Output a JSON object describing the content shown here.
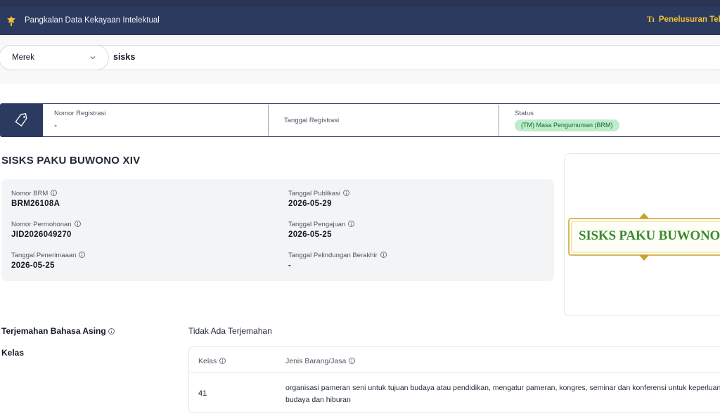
{
  "header": {
    "title": "Pangkalan Data Kekayaan Intelektual",
    "right_link_prefix": "Tı",
    "right_link": "Penelusuran Tek"
  },
  "search": {
    "type_selected": "Merek",
    "query": "sisks"
  },
  "registration": {
    "nomor_label": "Nomor Registrasi",
    "nomor_value": "-",
    "tanggal_label": "Tanggal Registrasi",
    "status_label": "Status",
    "status_badge": "(TM) Masa Pengumuman (BRM)"
  },
  "mark": {
    "title": "SISKS PAKU BUWONO XIV",
    "logo_text": "SISKS PAKU BUWONO XIV"
  },
  "details": {
    "nomor_brm_label": "Nomor BRM",
    "nomor_brm": "BRM26108A",
    "nomor_permohonan_label": "Nomor Permohonan",
    "nomor_permohonan": "JID2026049270",
    "tanggal_penerimaan_label": "Tanggal Penerimaaan",
    "tanggal_penerimaan": "2026-05-25",
    "tanggal_publikasi_label": "Tanggal Publikasi",
    "tanggal_publikasi": "2026-05-29",
    "tanggal_pengajuan_label": "Tanggal Pengajuan",
    "tanggal_pengajuan": "2026-05-25",
    "tanggal_pelindungan_label": "Tanggal Pelindungan Berakhir",
    "tanggal_pelindungan": "-"
  },
  "terjemahan": {
    "label": "Terjemahan Bahasa Asing",
    "value": "Tidak Ada Terjemahan"
  },
  "kelas": {
    "label": "Kelas",
    "col_kelas": "Kelas",
    "col_jenis": "Jenis Barang/Jasa",
    "rows": [
      {
        "kelas": "41",
        "jenis": "organisasi pameran seni untuk tujuan budaya atau pendidikan, mengatur pameran, kongres, seminar dan konferensi untuk keperluan budaya dan hiburan"
      }
    ]
  },
  "colors": {
    "header_bg": "#2d3a60",
    "accent_yellow": "#f2c230",
    "badge_bg": "#bfeccb",
    "badge_text": "#116b34",
    "logo_green": "#3c8a2e"
  },
  "icons": {
    "header_logo": "garuda-emblem-icon",
    "registration": "tag-icon",
    "select": "chevron-down-icon",
    "info": "info-icon"
  }
}
